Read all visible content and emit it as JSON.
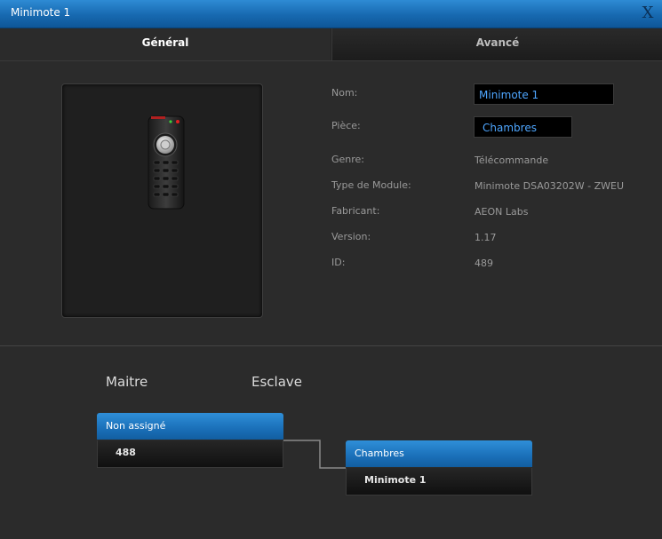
{
  "window": {
    "title": "Minimote 1",
    "close_label": "X"
  },
  "tabs": [
    {
      "label": "Général",
      "active": true
    },
    {
      "label": "Avancé",
      "active": false
    }
  ],
  "device": {
    "fields": {
      "nom": {
        "label": "Nom:",
        "value": "Minimote 1"
      },
      "piece": {
        "label": "Pièce:",
        "value": "Chambres"
      },
      "genre": {
        "label": "Genre:",
        "value": "Télécommande"
      },
      "type_module": {
        "label": "Type de Module:",
        "value": "Minimote DSA03202W - ZWEU"
      },
      "fabricant": {
        "label": "Fabricant:",
        "value": "AEON Labs"
      },
      "version": {
        "label": "Version:",
        "value": "1.17"
      },
      "id": {
        "label": "ID:",
        "value": "489"
      }
    }
  },
  "association": {
    "master_heading": "Maitre",
    "slave_heading": "Esclave",
    "master_node": {
      "header": "Non assigné",
      "item": "488"
    },
    "slave_node": {
      "header": "Chambres",
      "item": "Minimote 1"
    }
  },
  "colors": {
    "accent": "#1a6fb8",
    "field_text": "#4ea6ff",
    "background": "#2b2b2b"
  }
}
